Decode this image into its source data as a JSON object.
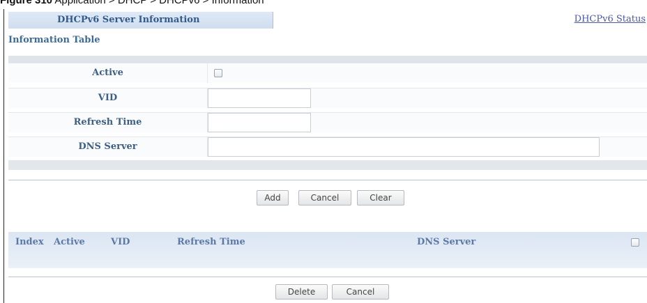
{
  "caption": {
    "prefix": "Figure 310",
    "path": "  Application > DHCP > DHCPv6 > Information"
  },
  "tab": {
    "title": "DHCPv6 Server Information"
  },
  "status_link": "DHCPv6 Status",
  "section_title": "Information Table",
  "form": {
    "active_label": "Active",
    "active_checked": false,
    "vid_label": "VID",
    "vid_value": "",
    "refresh_label": "Refresh Time",
    "refresh_value": "",
    "dns_label": "DNS Server",
    "dns_value": ""
  },
  "buttons": {
    "add": "Add",
    "cancel": "Cancel",
    "clear": "Clear",
    "delete": "Delete",
    "cancel2": "Cancel"
  },
  "table": {
    "columns": [
      "Index",
      "Active",
      "VID",
      "Refresh Time",
      "DNS Server"
    ],
    "select_all_checked": false,
    "rows": []
  }
}
